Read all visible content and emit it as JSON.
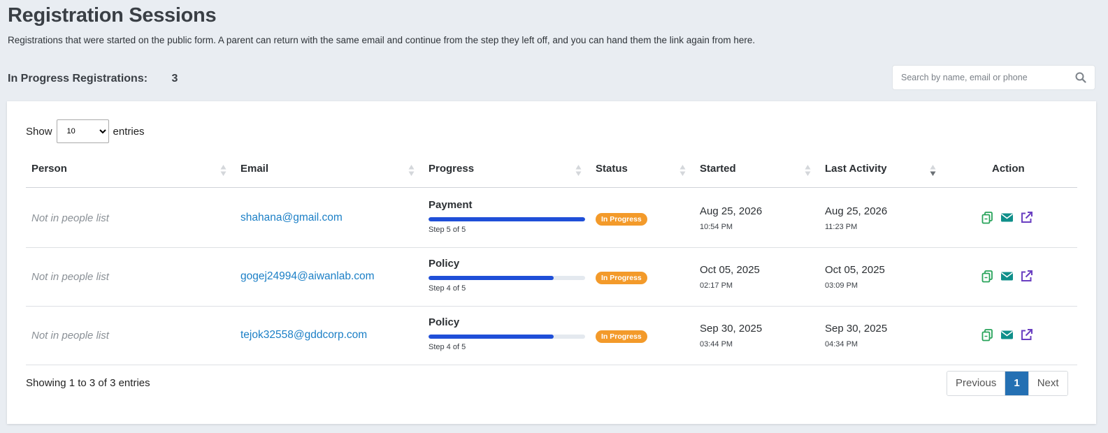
{
  "page": {
    "title": "Registration Sessions",
    "description": "Registrations that were started on the public form. A parent can return with the same email and continue from the step they left off, and you can hand them the link again from here.",
    "count_label": "In Progress Registrations:",
    "count_value": "3"
  },
  "search": {
    "placeholder": "Search by name, email or phone",
    "value": "",
    "icon": "search-icon"
  },
  "length": {
    "show_label": "Show",
    "entries_label": "entries",
    "selected": "10"
  },
  "columns": [
    "Person",
    "Email",
    "Progress",
    "Status",
    "Started",
    "Last Activity",
    "Action"
  ],
  "rows": [
    {
      "person": "Not in people list",
      "email": "shahana@gmail.com",
      "progress_label": "Payment",
      "progress_step": "Step 5 of 5",
      "progress_fraction": 1.0,
      "status": "In Progress",
      "started_date": "Aug 25, 2026",
      "started_time": "10:54 PM",
      "last_date": "Aug 25, 2026",
      "last_time": "11:23 PM"
    },
    {
      "person": "Not in people list",
      "email": "gogej24994@aiwanlab.com",
      "progress_label": "Policy",
      "progress_step": "Step 4 of 5",
      "progress_fraction": 0.8,
      "status": "In Progress",
      "started_date": "Oct 05, 2025",
      "started_time": "02:17 PM",
      "last_date": "Oct 05, 2025",
      "last_time": "03:09 PM"
    },
    {
      "person": "Not in people list",
      "email": "tejok32558@gddcorp.com",
      "progress_label": "Policy",
      "progress_step": "Step 4 of 5",
      "progress_fraction": 0.8,
      "status": "In Progress",
      "started_date": "Sep 30, 2025",
      "started_time": "03:44 PM",
      "last_date": "Sep 30, 2025",
      "last_time": "04:34 PM"
    }
  ],
  "actions": [
    "copy-link-icon",
    "email-icon",
    "external-link-icon"
  ],
  "footer": {
    "info": "Showing 1 to 3 of 3 entries",
    "previous": "Previous",
    "page": "1",
    "next": "Next"
  },
  "colors": {
    "badge": "#f39a2a",
    "progress": "#1f4fd8",
    "link": "#1b7fc6",
    "copy_icon": "#27a35a",
    "email_icon": "#0f8f8a",
    "open_icon": "#6a3fc1",
    "page_active": "#2470b3"
  }
}
